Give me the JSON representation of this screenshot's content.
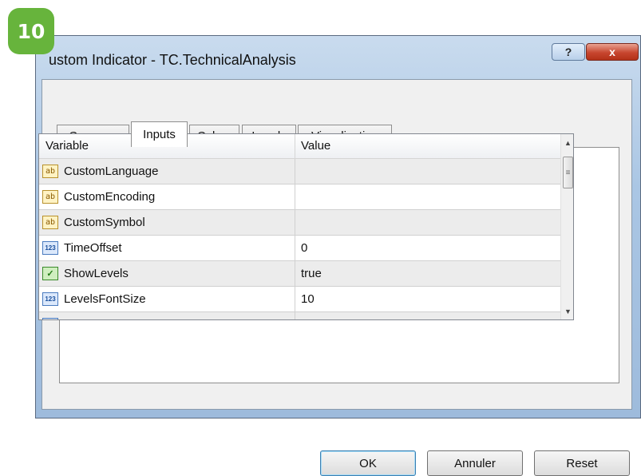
{
  "badge": "10",
  "window": {
    "title": "ustom Indicator - TC.TechnicalAnalysis",
    "help_label": "?",
    "close_label": "x"
  },
  "tabs": [
    "Common",
    "Inputs",
    "Colors",
    "Levels",
    "Visualization"
  ],
  "active_tab": "Inputs",
  "grid": {
    "columns": [
      "Variable",
      "Value"
    ],
    "rows": [
      {
        "icon": "ab",
        "type": "string",
        "name": "CustomLanguage",
        "value": ""
      },
      {
        "icon": "ab",
        "type": "string",
        "name": "CustomEncoding",
        "value": ""
      },
      {
        "icon": "ab",
        "type": "string",
        "name": "CustomSymbol",
        "value": ""
      },
      {
        "icon": "123",
        "type": "number",
        "name": "TimeOffset",
        "value": "0"
      },
      {
        "icon": "check",
        "type": "bool",
        "name": "ShowLevels",
        "value": "true"
      },
      {
        "icon": "123",
        "type": "number",
        "name": "LevelsFontSize",
        "value": "10"
      }
    ]
  },
  "buttons": {
    "ok": "OK",
    "cancel": "Annuler",
    "reset": "Reset"
  }
}
